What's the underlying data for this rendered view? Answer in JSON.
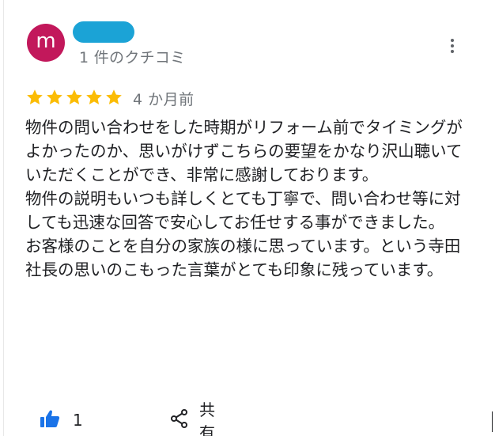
{
  "review": {
    "avatar_letter": "m",
    "reviewer_count_text": "1 件のクチコミ",
    "rating": 5,
    "time_ago": "4 か月前",
    "text": "物件の問い合わせをした時期がリフォーム前でタイミングがよかったのか、思いがけずこちらの要望をかなり沢山聴いていただくことができ、非常に感謝しております。\n物件の説明もいつも詳しくとても丁寧で、問い合わせ等に対しても迅速な回答で安心してお任せする事ができました。\nお客様のことを自分の家族の様に思っています。という寺田社長の思いのこもった言葉がとても印象に残っています。",
    "like_count": "1",
    "share_label": "共有"
  },
  "colors": {
    "avatar_bg": "#c2185b",
    "name_redaction": "#1ba3d6",
    "star": "#fbbc04",
    "like_icon": "#1a73e8"
  },
  "icons": [
    "more-vert-icon",
    "star-icon",
    "thumbs-up-icon",
    "share-icon"
  ]
}
